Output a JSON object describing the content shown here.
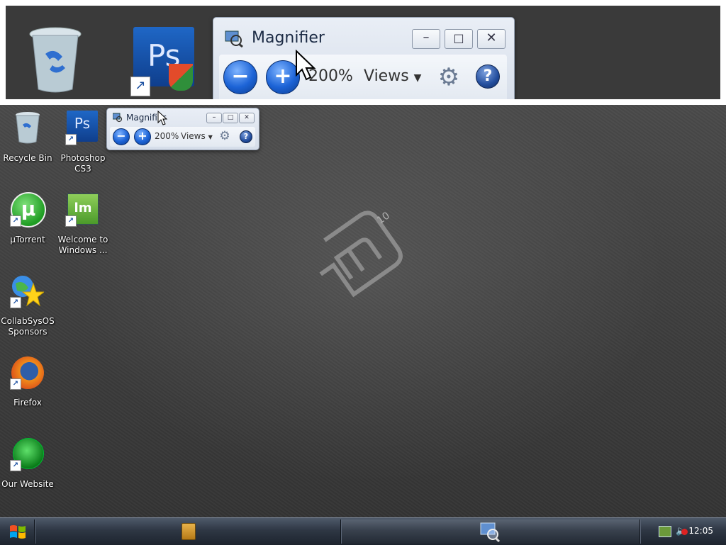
{
  "magnifier": {
    "title": "Magnifier",
    "zoom_level": "200%",
    "views_label": "Views",
    "zoom_out_icon": "minus-circle-icon",
    "zoom_in_icon": "plus-circle-icon",
    "options_icon": "gear-icon",
    "help_icon": "question-icon"
  },
  "desktop": {
    "icons": [
      {
        "label": "Recycle Bin",
        "icon": "recycle-bin-icon"
      },
      {
        "label": "Photoshop CS3",
        "icon": "photoshop-icon"
      },
      {
        "label": "µTorrent",
        "icon": "utorrent-icon"
      },
      {
        "label": "Welcome to Windows ...",
        "icon": "mint-icon"
      },
      {
        "label": "CollabSysOS Sponsors",
        "icon": "globe-star-icon"
      },
      {
        "label": "Firefox",
        "icon": "firefox-icon"
      },
      {
        "label": "Our Website",
        "icon": "website-icon"
      }
    ],
    "wallpaper_mark": "10"
  },
  "taskbar": {
    "clock": "12:05",
    "start_icon": "windows-flag-icon",
    "quicklaunch_icon": "file-cabinet-icon",
    "task_icon": "magnifier-app-icon",
    "tray_icons": [
      "network-icon",
      "volume-muted-icon"
    ]
  },
  "colors": {
    "taskbar": "#2e3744",
    "desktop": "#3c3c3c",
    "accent": "#1c63d6"
  }
}
